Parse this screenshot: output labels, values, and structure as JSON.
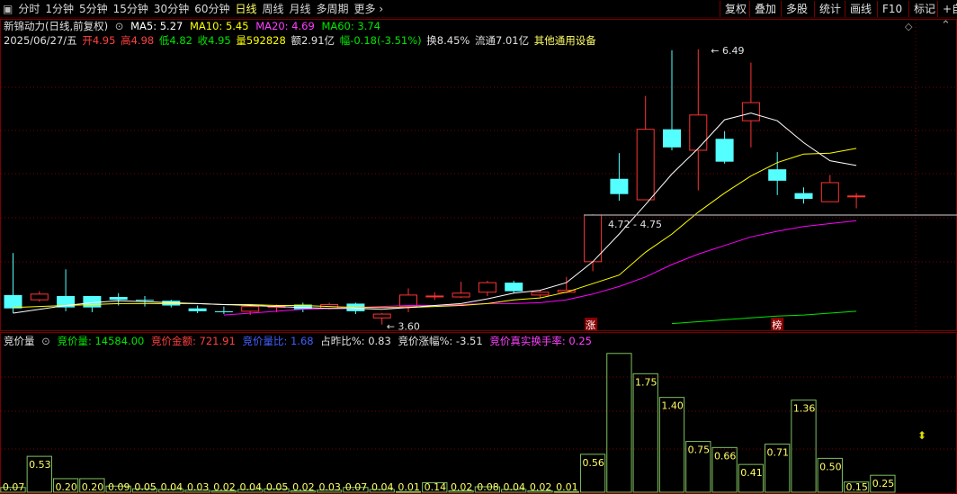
{
  "toolbar": {
    "periods": [
      "分时",
      "1分钟",
      "5分钟",
      "15分钟",
      "30分钟",
      "60分钟",
      "日线",
      "周线",
      "月线",
      "多周期",
      "更多"
    ],
    "active_period": "日线",
    "right_buttons": [
      "复权",
      "叠加",
      "多股",
      "统计",
      "画线",
      "F10",
      "标记",
      "+自"
    ]
  },
  "info": {
    "stock_title": "新锦动力(日线,前复权)",
    "ma5": "MA5: 5.27",
    "ma10": "MA10: 5.45",
    "ma20": "MA20: 4.69",
    "ma60": "MA60: 3.74",
    "date": "2025/06/27/五",
    "open": "开4.95",
    "high": "高4.98",
    "low": "低4.82",
    "close": "收4.95",
    "volume": "量592828",
    "amount": "额2.91亿",
    "change": "幅-0.18(-3.51%)",
    "turnover": "换8.45%",
    "float_cap": "流通7.01亿",
    "concept": "其他通用设备"
  },
  "annotations": {
    "high_label": "6.49",
    "low_label": "3.60",
    "range_label": "4.72 - 4.75",
    "tag_zhang": "涨",
    "tag_bang": "榜"
  },
  "sub": {
    "name": "竞价量",
    "vol": "竞价量: 14584.00",
    "amount": "竞价金额: 721.91",
    "ratio": "竞价量比: 1.68",
    "prev_pct": "占昨比%: 0.83",
    "chg_pct": "竞价涨幅%: -3.51",
    "turnover": "竞价真实换手率: 0.25"
  },
  "colors": {
    "up": "#ff3232",
    "down": "#54ffff",
    "ma5": "#ffffff",
    "ma10": "#ffff00",
    "ma20": "#ff00ff",
    "ma60": "#00e600",
    "grid": "#7a0000",
    "green_bar": "#7fbf5f",
    "label_yellow": "#ffff66"
  },
  "chart_data": {
    "type": "candlestick",
    "candles": [
      {
        "o": 3.91,
        "c": 3.77,
        "h": 4.35,
        "l": 3.72
      },
      {
        "o": 3.86,
        "c": 3.92,
        "h": 3.95,
        "l": 3.84
      },
      {
        "o": 3.9,
        "c": 3.78,
        "h": 4.18,
        "l": 3.74
      },
      {
        "o": 3.9,
        "c": 3.78,
        "h": 3.9,
        "l": 3.73
      },
      {
        "o": 3.89,
        "c": 3.86,
        "h": 3.93,
        "l": 3.8
      },
      {
        "o": 3.86,
        "c": 3.85,
        "h": 3.9,
        "l": 3.79
      },
      {
        "o": 3.85,
        "c": 3.8,
        "h": 3.86,
        "l": 3.78
      },
      {
        "o": 3.77,
        "c": 3.74,
        "h": 3.8,
        "l": 3.72
      },
      {
        "o": 3.74,
        "c": 3.73,
        "h": 3.79,
        "l": 3.71
      },
      {
        "o": 3.74,
        "c": 3.79,
        "h": 3.8,
        "l": 3.7
      },
      {
        "o": 3.78,
        "c": 3.79,
        "h": 3.81,
        "l": 3.73
      },
      {
        "o": 3.81,
        "c": 3.76,
        "h": 3.83,
        "l": 3.73
      },
      {
        "o": 3.77,
        "c": 3.81,
        "h": 3.83,
        "l": 3.76
      },
      {
        "o": 3.82,
        "c": 3.74,
        "h": 3.83,
        "l": 3.71
      },
      {
        "o": 3.67,
        "c": 3.71,
        "h": 3.72,
        "l": 3.6
      },
      {
        "o": 3.79,
        "c": 3.91,
        "h": 3.98,
        "l": 3.73
      },
      {
        "o": 3.9,
        "c": 3.9,
        "h": 3.94,
        "l": 3.86
      },
      {
        "o": 3.89,
        "c": 3.93,
        "h": 4.05,
        "l": 3.88
      },
      {
        "o": 3.94,
        "c": 4.04,
        "h": 4.06,
        "l": 3.9
      },
      {
        "o": 4.04,
        "c": 3.95,
        "h": 4.06,
        "l": 3.93
      },
      {
        "o": 3.91,
        "c": 3.94,
        "h": 3.96,
        "l": 3.88
      },
      {
        "o": 3.94,
        "c": 3.96,
        "h": 4.1,
        "l": 3.93
      },
      {
        "o": 4.26,
        "c": 4.75,
        "h": 4.76,
        "l": 4.16
      },
      {
        "o": 5.13,
        "c": 4.97,
        "h": 5.4,
        "l": 4.9
      },
      {
        "o": 4.91,
        "c": 5.65,
        "h": 6.0,
        "l": 4.91
      },
      {
        "o": 5.65,
        "c": 5.46,
        "h": 6.48,
        "l": 5.43
      },
      {
        "o": 5.43,
        "c": 5.8,
        "h": 6.49,
        "l": 5.01
      },
      {
        "o": 5.55,
        "c": 5.31,
        "h": 5.63,
        "l": 5.29
      },
      {
        "o": 5.74,
        "c": 5.93,
        "h": 6.35,
        "l": 5.46
      },
      {
        "o": 5.23,
        "c": 5.11,
        "h": 5.41,
        "l": 4.96
      },
      {
        "o": 4.98,
        "c": 4.92,
        "h": 5.04,
        "l": 4.87
      },
      {
        "o": 4.89,
        "c": 5.09,
        "h": 5.17,
        "l": 4.89
      },
      {
        "o": 4.95,
        "c": 4.95,
        "h": 4.98,
        "l": 4.82
      }
    ],
    "ma5": [
      3.72,
      3.76,
      3.8,
      3.83,
      3.85,
      3.84,
      3.83,
      3.82,
      3.81,
      3.8,
      3.79,
      3.78,
      3.77,
      3.77,
      3.76,
      3.78,
      3.8,
      3.82,
      3.87,
      3.93,
      3.96,
      4.04,
      4.26,
      4.55,
      4.86,
      5.18,
      5.45,
      5.75,
      5.82,
      5.74,
      5.51,
      5.32,
      5.27
    ],
    "ma10": [
      3.78,
      3.79,
      3.8,
      3.81,
      3.82,
      3.82,
      3.82,
      3.82,
      3.81,
      3.81,
      3.8,
      3.8,
      3.79,
      3.78,
      3.78,
      3.78,
      3.79,
      3.8,
      3.82,
      3.86,
      3.88,
      3.94,
      4.03,
      4.12,
      4.36,
      4.55,
      4.78,
      4.98,
      5.16,
      5.3,
      5.39,
      5.4,
      5.45
    ],
    "ma20": [
      null,
      null,
      null,
      null,
      null,
      null,
      null,
      null,
      3.7,
      3.72,
      3.74,
      3.76,
      3.77,
      3.78,
      3.79,
      3.8,
      3.8,
      3.81,
      3.82,
      3.82,
      3.83,
      3.86,
      3.92,
      4.0,
      4.1,
      4.23,
      4.34,
      4.43,
      4.52,
      4.58,
      4.63,
      4.66,
      4.69
    ],
    "ma60": [
      null,
      null,
      null,
      null,
      null,
      null,
      null,
      null,
      null,
      null,
      null,
      null,
      null,
      null,
      null,
      null,
      null,
      null,
      null,
      null,
      null,
      null,
      null,
      null,
      null,
      3.61,
      3.63,
      3.65,
      3.67,
      3.69,
      3.7,
      3.72,
      3.74
    ],
    "ylim": [
      3.55,
      6.62
    ],
    "auction_volume_ratio": [
      0.07,
      0.53,
      0.2,
      0.2,
      0.09,
      0.05,
      0.04,
      0.03,
      0.02,
      0.04,
      0.05,
      0.02,
      0.03,
      0.07,
      0.04,
      0.01,
      0.14,
      0.02,
      0.08,
      0.04,
      0.02,
      0.01,
      0.56,
      2.05,
      1.75,
      1.4,
      0.75,
      0.66,
      0.41,
      0.71,
      1.36,
      0.5,
      0.15,
      0.25
    ],
    "auction_labels": [
      "0.07",
      "0.53",
      "0.20",
      "0.20",
      "0.09",
      "0.05",
      "0.04",
      "0.03",
      "0.02",
      "0.04",
      "0.05",
      "0.02",
      "0.03",
      "0.07",
      "0.04",
      "0.01",
      "0.14",
      "0.02",
      "0.08",
      "0.04",
      "0.02",
      "0.01",
      "0.56",
      "",
      "1.75",
      "1.40",
      "0.75",
      "0.66",
      "0.41",
      "0.71",
      "1.36",
      "0.50",
      "0.15",
      "0.25"
    ],
    "sub_ylim": [
      0,
      2.1
    ]
  }
}
